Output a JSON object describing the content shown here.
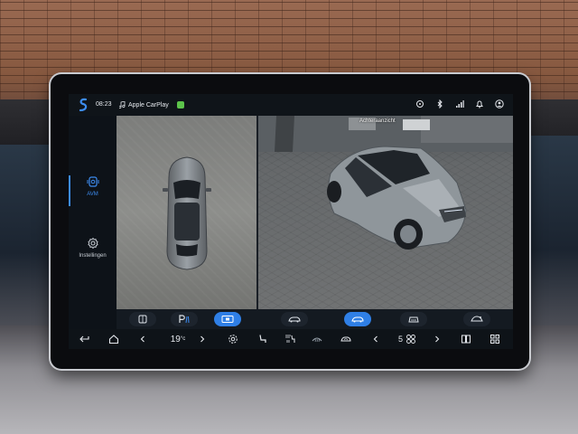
{
  "status_bar": {
    "time": "08:23",
    "carplay_label": "Apple CarPlay"
  },
  "nav": {
    "items": [
      {
        "label": "AVM",
        "icon": "camera-icon",
        "active": true
      },
      {
        "label": "Instellingen",
        "icon": "gear-icon",
        "active": false
      }
    ]
  },
  "camera": {
    "view_label": "Achteraanzicht",
    "toolbar_buttons": [
      {
        "icon": "door-mirror-icon",
        "active": false
      },
      {
        "icon": "parking-assist-icon",
        "active": false
      },
      {
        "icon": "camera-view-icon",
        "active": true
      },
      {
        "icon": "car-view-front-icon",
        "active": false
      },
      {
        "icon": "car-view-side-icon",
        "active": true
      },
      {
        "icon": "car-view-rear-icon",
        "active": false
      },
      {
        "icon": "car-view-top-icon",
        "active": false
      }
    ]
  },
  "system_bar": {
    "driver_temp": "19",
    "driver_temp_unit": "°c",
    "fan_level": "5"
  },
  "colors": {
    "accent": "#2f7fe6",
    "background": "#10151b"
  }
}
